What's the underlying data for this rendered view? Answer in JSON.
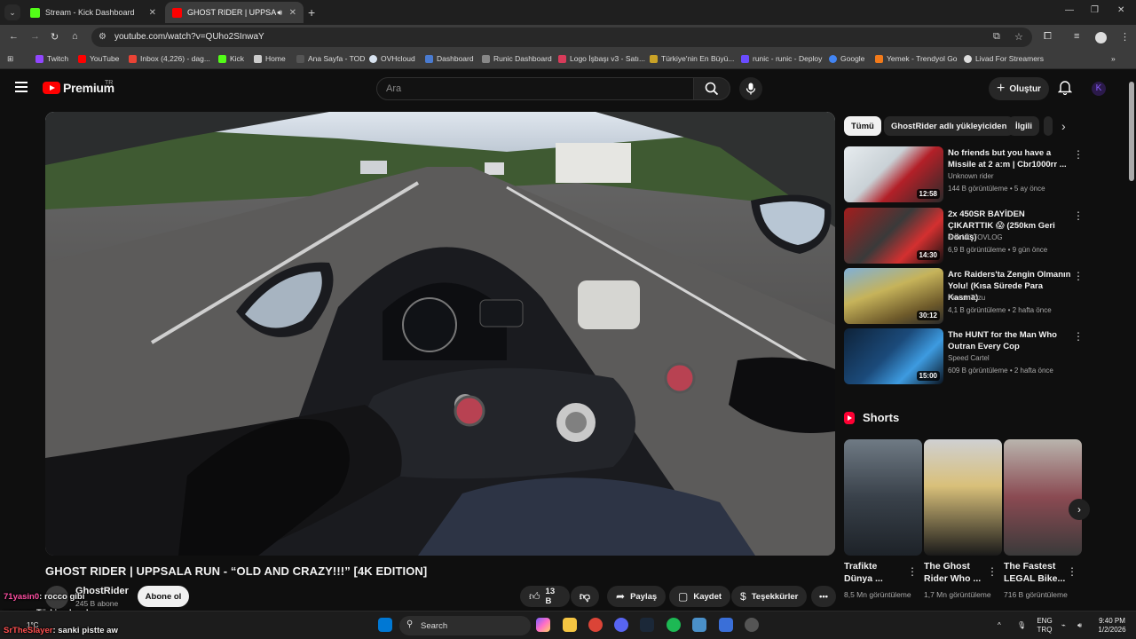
{
  "browser": {
    "tabs": [
      {
        "title": "Stream - Kick Dashboard",
        "color": "#53fc18",
        "active": false
      },
      {
        "title": "GHOST RIDER | UPPSALA R",
        "color": "#ff0000",
        "active": true
      }
    ],
    "url": "youtube.com/watch?v=QUho2SInwaY",
    "bookmarks": [
      {
        "label": "Twitch",
        "color": "#9146ff"
      },
      {
        "label": "YouTube",
        "color": "#ff0000"
      },
      {
        "label": "Inbox (4,226) - dag...",
        "color": "#ea4335"
      },
      {
        "label": "Kick",
        "color": "#53fc18"
      },
      {
        "label": "Home",
        "color": "#cccccc"
      },
      {
        "label": "Ana Sayfa - TOD",
        "color": "#444444"
      },
      {
        "label": "OVHcloud",
        "color": "#123f6d"
      },
      {
        "label": "Dashboard",
        "color": "#4a7bd0"
      },
      {
        "label": "Runic Dashboard",
        "color": "#888888"
      },
      {
        "label": "Logo İşbaşı v3 - Satı...",
        "color": "#d83b5a"
      },
      {
        "label": "Türkiye'nin En Büyü...",
        "color": "#c9a227"
      },
      {
        "label": "runic - runic - Deploy",
        "color": "#6a4cff"
      },
      {
        "label": "Google",
        "color": "#4285f4"
      },
      {
        "label": "Yemek - Trendyol Go",
        "color": "#f27a1a"
      },
      {
        "label": "Livad For Streamers",
        "color": "#dddddd"
      }
    ]
  },
  "youtube": {
    "logo_text": "Premium",
    "region": "TR",
    "search_placeholder": "Ara",
    "create_label": "Oluştur",
    "avatar_letter": "K"
  },
  "video": {
    "title": "GHOST RIDER | UPPSALA RUN - “OLD AND CRAZY!!!” [4K EDITION]",
    "channel": "GhostRider",
    "subscribers": "245 B abone",
    "subscribe_label": "Abone ol",
    "likes": "13 B",
    "share_label": "Paylaş",
    "save_label": "Kaydet",
    "thanks_label": "Teşekkürler",
    "more_label": "•••"
  },
  "chat_overlay": [
    {
      "user": "71yasin0",
      "text": ": rocco gibi",
      "color": "#ff4fa3"
    },
    {
      "user": "woverr",
      "text": ": Türkiyede vdm yer",
      "color": "#b36bff"
    },
    {
      "user": "SrTheSlayer",
      "text": ": sanki pistte aw",
      "color": "#ff4f4f"
    }
  ],
  "filters": {
    "chips": [
      "Tümü",
      "GhostRider adlı yükleyiciden",
      "İlgili"
    ]
  },
  "recommendations": [
    {
      "title": "No friends but you have a Missile at 2 a:m | Cbr1000rr ...",
      "channel": "Unknown rider",
      "meta": "144 B görüntüleme • 5 ay önce",
      "duration": "12:58"
    },
    {
      "title": "2x 450SR BAYİDEN ÇIKARTTIK 😱 (250km Geri Dönüş)",
      "channel": "on6 MOTOVLOG",
      "meta": "6,9 B görüntüleme • 9 gün önce",
      "duration": "14:30"
    },
    {
      "title": "Arc Raiders'ta Zengin Olmanın Yolu! (Kısa Sürede Para Kasma)",
      "channel": "ProteinTozu",
      "meta": "4,1 B görüntüleme • 2 hafta önce",
      "duration": "30:12"
    },
    {
      "title": "The HUNT for the Man Who Outran Every Cop",
      "channel": "Speed Cartel",
      "meta": "609 B görüntüleme • 2 hafta önce",
      "duration": "15:00"
    }
  ],
  "shorts": {
    "heading": "Shorts",
    "items": [
      {
        "title": "Trafikte Dünya ...",
        "views": "8,5 Mn görüntüleme"
      },
      {
        "title": "The Ghost Rider Who ...",
        "views": "1,7 Mn görüntüleme"
      },
      {
        "title": "The Fastest LEGAL Bike...",
        "views": "716 B görüntüleme"
      }
    ]
  },
  "taskbar": {
    "search_label": "Search",
    "weather": "1°C",
    "lang_top": "ENG",
    "lang_bottom": "TRQ",
    "time": "9:40 PM",
    "date": "1/2/2026"
  }
}
